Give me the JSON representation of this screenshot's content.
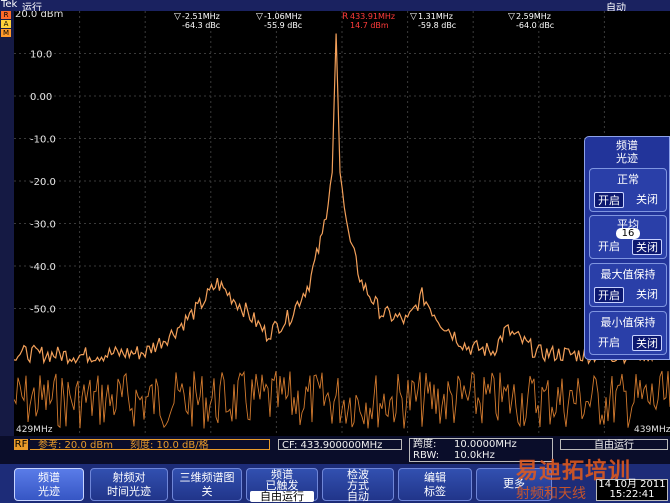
{
  "status": {
    "brand": "Tek",
    "run_state": "运行",
    "top_right": "自动"
  },
  "side_tags": [
    "R",
    "A",
    "M"
  ],
  "plot": {
    "ref_level_label": "20.0 dBm",
    "y_tick_labels": [
      "10.0",
      "0.00",
      "-10.0",
      "-20.0",
      "-30.0",
      "-40.0",
      "-50.0"
    ],
    "freq_start_label": "429MHz",
    "freq_stop_label": "439MHz",
    "markers": [
      {
        "id": "m1",
        "freq_label": "-2.51MHz",
        "level_label": "-64.3 dBc",
        "color": "#ffffff"
      },
      {
        "id": "m2",
        "freq_label": "-1.06MHz",
        "level_label": "-55.9 dBc",
        "color": "#ffffff"
      },
      {
        "id": "ref",
        "freq_label": "433.91MHz",
        "level_label": "14.7 dBm",
        "color": "#ff3b3b"
      },
      {
        "id": "m3",
        "freq_label": "1.31MHz",
        "level_label": "-59.8 dBc",
        "color": "#ffffff"
      },
      {
        "id": "m4",
        "freq_label": "2.59MHz",
        "level_label": "-64.0 dBc",
        "color": "#ffffff"
      }
    ],
    "ref_badge": "R",
    "trace_color": "#f3a05a",
    "noise_color": "#d27a2e",
    "grid_color": "#3a3a3a"
  },
  "chart_data": {
    "type": "line",
    "xlabel": "",
    "ylabel": "",
    "xlim": [
      429,
      439
    ],
    "ylim": [
      -80,
      20
    ],
    "y_ticks": [
      10,
      0,
      -10,
      -20,
      -30,
      -40,
      -50
    ],
    "series": [
      {
        "name": "",
        "x": [
          429.0,
          430.0,
          431.0,
          431.4,
          431.8,
          432.1,
          432.5,
          432.85,
          433.2,
          433.5,
          433.7,
          433.85,
          433.91,
          433.97,
          434.1,
          434.3,
          434.6,
          435.0,
          435.22,
          435.5,
          435.9,
          436.3,
          436.5,
          437.0,
          438.0,
          439.0
        ],
        "y": [
          -60.5,
          -61,
          -60.3,
          -56,
          -50,
          -44,
          -50,
          -56,
          -52,
          -44,
          -33,
          -18,
          14.7,
          -18,
          -33,
          -44,
          -51,
          -53,
          -47,
          -53,
          -59,
          -60,
          -55,
          -60.5,
          -61,
          -60.5
        ]
      }
    ]
  },
  "status_row": {
    "rf_badge": "RF",
    "ref_text": "参考: 20.0 dBm",
    "scale_text": "刻度: 10.0 dB/格",
    "cf_text": "CF:  433.900000MHz",
    "span_label": "跨度:",
    "span_value": "10.0000MHz",
    "rbw_label": "RBW:",
    "rbw_value": "10.0kHz",
    "run_text": "自由运行"
  },
  "softkeys": [
    {
      "line1": "频谱",
      "line2": "光迹",
      "active": true
    },
    {
      "line1": "射频对",
      "line2": "时间光迹",
      "active": false
    },
    {
      "line1": "三维频谱图",
      "line2": "关",
      "active": false
    },
    {
      "line1": "频谱",
      "line2": "已触发",
      "line3": "自由运行",
      "active": false
    },
    {
      "line1": "检波",
      "line2": "方式",
      "line3": "自动",
      "active": false
    },
    {
      "line1": "编辑",
      "line2": "标签",
      "active": false
    },
    {
      "line1": "更多",
      "line2": "",
      "active": false
    }
  ],
  "side_menu": {
    "title_line1": "频谱",
    "title_line2": "光迹",
    "groups": [
      {
        "title": "正常",
        "on": "开启",
        "off": "关闭",
        "selected": "on"
      },
      {
        "title": "平均",
        "value": "16",
        "on": "开启",
        "off": "关闭",
        "selected": "off"
      },
      {
        "title": "最大值保持",
        "on": "开启",
        "off": "关闭",
        "selected": "on"
      },
      {
        "title": "最小值保持",
        "on": "开启",
        "off": "关闭",
        "selected": "off"
      }
    ]
  },
  "clock": {
    "date": "14 10月 2011",
    "time": "15:22:41"
  },
  "watermark": {
    "line1": "易迪拓培训",
    "line2": "射频和天线"
  }
}
